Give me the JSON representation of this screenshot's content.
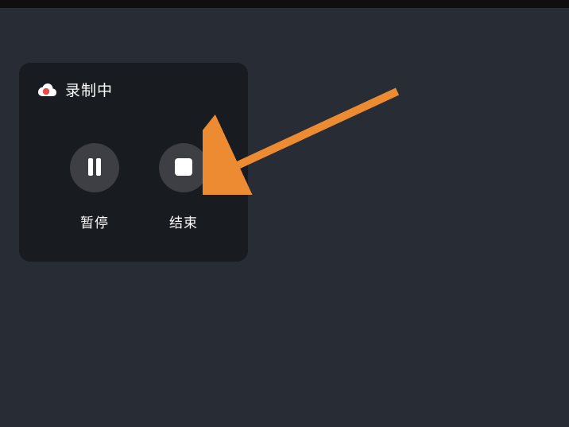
{
  "panel": {
    "title": "录制中",
    "pause_label": "暂停",
    "stop_label": "结束"
  },
  "colors": {
    "background": "#272c35",
    "panel": "#181b20",
    "button": "#3d3f44",
    "text": "#fdfdfd",
    "record_dot": "#e94b4b",
    "arrow": "#ed8b33"
  }
}
